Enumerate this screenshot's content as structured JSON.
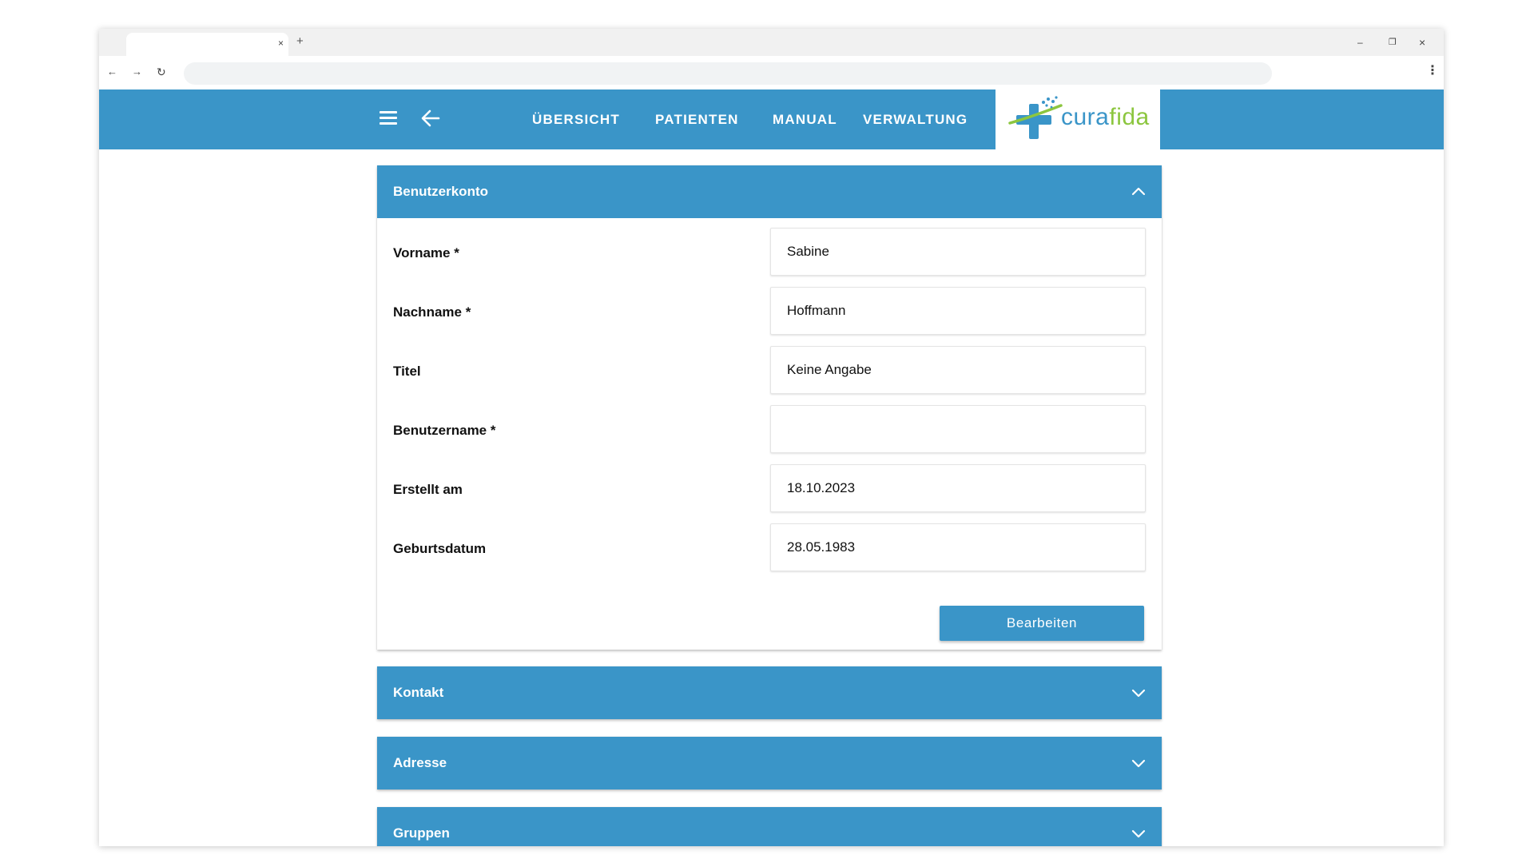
{
  "browser": {
    "tab_close": "×",
    "new_tab": "+",
    "minimize": "–",
    "restore": "❐",
    "close": "×",
    "nav_back": "←",
    "nav_forward": "→",
    "reload": "↻",
    "menu": "⋮"
  },
  "header": {
    "nav": [
      "ÜBERSICHT",
      "PATIENTEN",
      "MANUAL",
      "VERWALTUNG"
    ],
    "logo": {
      "part1": "cura",
      "part2": "fida"
    },
    "colors": {
      "primary": "#3a95c8",
      "logo_green": "#8cc63f"
    }
  },
  "account_panel": {
    "title": "Benutzerkonto",
    "expanded": true,
    "fields": [
      {
        "label": "Vorname *",
        "value": "Sabine"
      },
      {
        "label": "Nachname *",
        "value": "Hoffmann"
      },
      {
        "label": "Titel",
        "value": "Keine Angabe"
      },
      {
        "label": "Benutzername *",
        "value": ""
      },
      {
        "label": "Erstellt am",
        "value": "18.10.2023"
      },
      {
        "label": "Geburtsdatum",
        "value": "28.05.1983"
      }
    ],
    "edit_button": "Bearbeiten"
  },
  "collapsed_panels": [
    "Kontakt",
    "Adresse",
    "Gruppen"
  ]
}
